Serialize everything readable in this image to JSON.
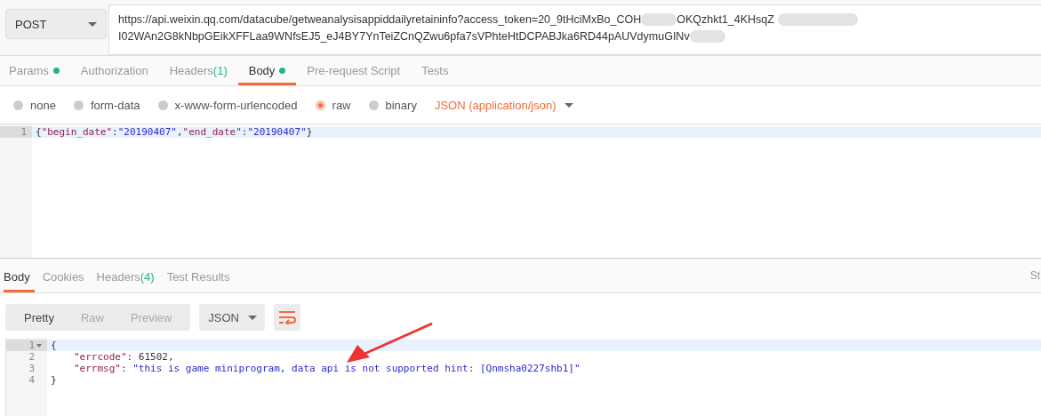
{
  "request": {
    "method": "POST",
    "url_lines": [
      {
        "before": "https://api.weixin.qq.com/datacube/getweanalysisappiddailyretaininfo?access_token=20_9tHciMxBo_COH",
        "after": "OKQzhkt1_4KHsqZ"
      },
      {
        "before": "I02WAn2G8kNbpGEikXFFLaa9WNfsEJ5_eJ4BY7YnTeiZCnQZwu6pfa7sVPhteHtDCPABJka6RD44pAUVdymuGINv"
      }
    ]
  },
  "request_tabs": [
    {
      "label": "Params",
      "dot": true,
      "selected": false
    },
    {
      "label": "Authorization",
      "dot": false,
      "selected": false
    },
    {
      "label": "Headers",
      "count": "(1)",
      "dot": false,
      "selected": false
    },
    {
      "label": "Body",
      "dot": true,
      "selected": true
    },
    {
      "label": "Pre-request Script",
      "dot": false,
      "selected": false
    },
    {
      "label": "Tests",
      "dot": false,
      "selected": false
    }
  ],
  "body_types": [
    {
      "label": "none",
      "selected": false
    },
    {
      "label": "form-data",
      "selected": false
    },
    {
      "label": "x-www-form-urlencoded",
      "selected": false
    },
    {
      "label": "raw",
      "selected": true
    },
    {
      "label": "binary",
      "selected": false
    }
  ],
  "content_type": "JSON (application/json)",
  "request_editor": [
    {
      "number": "1",
      "fold": false,
      "active": true,
      "indented": false,
      "tokens": [
        {
          "kind": "punct",
          "text": "{"
        },
        {
          "kind": "key",
          "text": "\"begin_date\""
        },
        {
          "kind": "punct",
          "text": ":"
        },
        {
          "kind": "string",
          "text": "\"20190407\""
        },
        {
          "kind": "punct",
          "text": ","
        },
        {
          "kind": "key",
          "text": "\"end_date\""
        },
        {
          "kind": "punct",
          "text": ":"
        },
        {
          "kind": "string",
          "text": "\"20190407\""
        },
        {
          "kind": "punct",
          "text": "}"
        }
      ]
    }
  ],
  "response_tabs": [
    {
      "label": "Body",
      "selected": true
    },
    {
      "label": "Cookies",
      "selected": false
    },
    {
      "label": "Headers",
      "count": "(4)",
      "selected": false
    },
    {
      "label": "Test Results",
      "selected": false
    }
  ],
  "status_partial": "St",
  "view_modes": [
    {
      "label": "Pretty",
      "selected": true
    },
    {
      "label": "Raw",
      "selected": false
    },
    {
      "label": "Preview",
      "selected": false
    }
  ],
  "format": "JSON",
  "response_editor": [
    {
      "number": "1",
      "fold": true,
      "active": true,
      "indented": false,
      "tokens": [
        {
          "kind": "punct",
          "text": "{"
        }
      ]
    },
    {
      "number": "2",
      "fold": false,
      "active": false,
      "indented": true,
      "tokens": [
        {
          "kind": "key",
          "text": "\"errcode\""
        },
        {
          "kind": "punct",
          "text": ": "
        },
        {
          "kind": "number",
          "text": "61502"
        },
        {
          "kind": "punct",
          "text": ","
        }
      ]
    },
    {
      "number": "3",
      "fold": false,
      "active": false,
      "indented": true,
      "tokens": [
        {
          "kind": "key",
          "text": "\"errmsg\""
        },
        {
          "kind": "punct",
          "text": ": "
        },
        {
          "kind": "string",
          "text": "\"this is game miniprogram, data api is not supported hint: [Qnmsha0227shb1]\""
        }
      ]
    },
    {
      "number": "4",
      "fold": false,
      "active": false,
      "indented": false,
      "tokens": [
        {
          "kind": "punct",
          "text": "}"
        }
      ]
    }
  ]
}
